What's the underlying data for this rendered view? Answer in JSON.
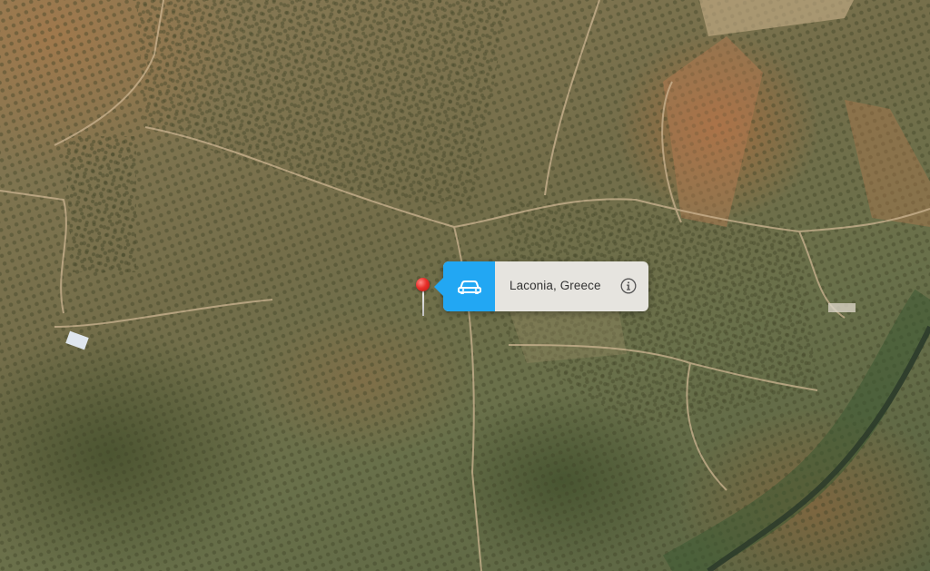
{
  "map": {
    "type": "satellite"
  },
  "callout": {
    "title": "Laconia, Greece",
    "directions_icon": "car-icon",
    "info_icon": "info-icon",
    "accent_color": "#22a7f3"
  },
  "pin": {
    "color": "#e8302a",
    "icon": "map-pin-icon"
  }
}
